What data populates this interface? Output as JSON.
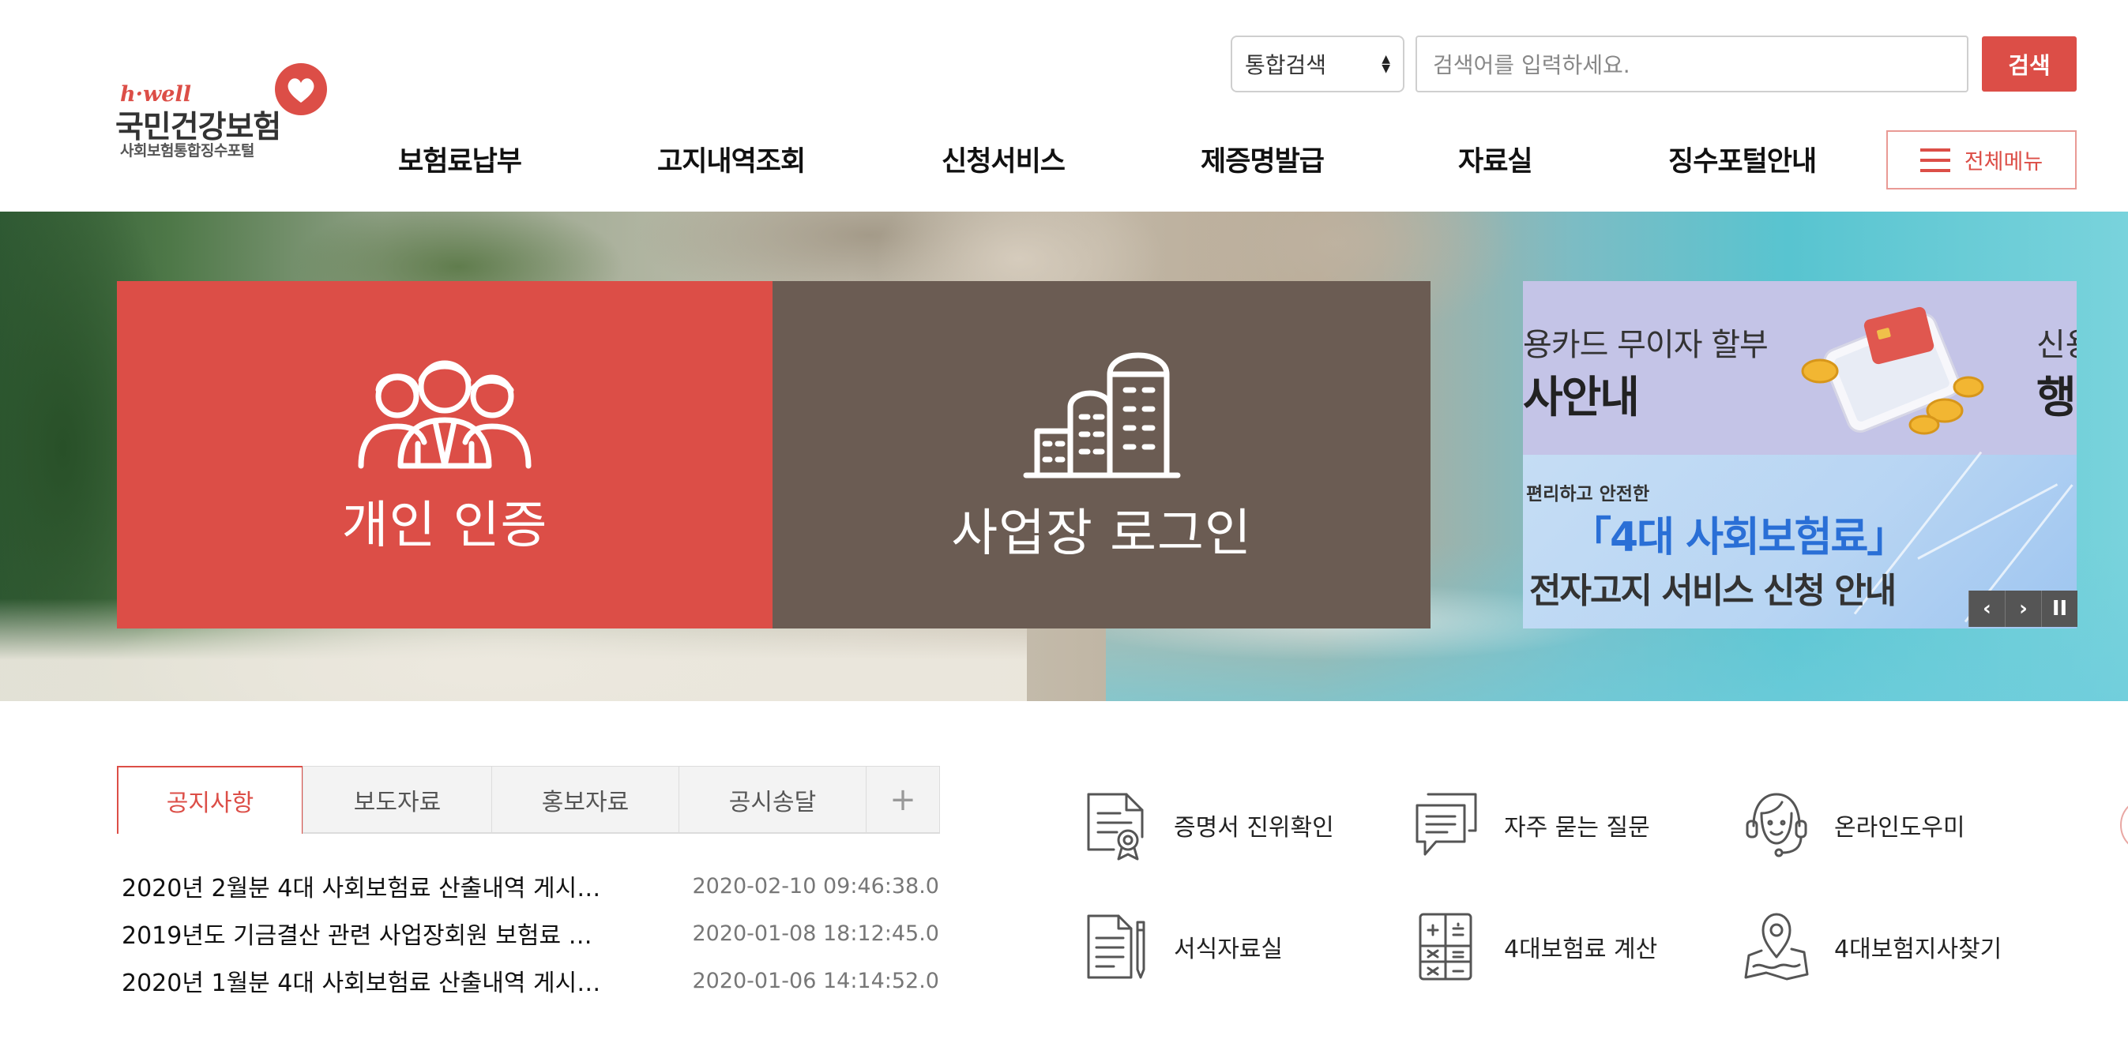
{
  "header": {
    "logo": {
      "tagline": "h·well",
      "brand": "국민건강보험",
      "sub": "사회보험통합징수포털"
    },
    "search": {
      "select_value": "통합검색",
      "placeholder": "검색어를 입력하세요.",
      "button_label": "검색"
    },
    "nav": [
      "보험료납부",
      "고지내역조회",
      "신청서비스",
      "제증명발급",
      "자료실",
      "징수포털안내"
    ],
    "all_menu_label": "전체메뉴"
  },
  "hero": {
    "personal_label": "개인 인증",
    "business_label": "사업장 로그인",
    "banner_top": {
      "line1": "용카드 무이자 할부",
      "line2": "사안내",
      "line3": "신용",
      "line4": "행"
    },
    "banner_bottom": {
      "line1": "편리하고 안전한",
      "line2": "「4대 사회보험료」",
      "line3": "전자고지 서비스 신청 안내"
    },
    "controls": {
      "prev": "‹",
      "next": "›",
      "pause": "II"
    }
  },
  "board": {
    "tabs": [
      "공지사항",
      "보도자료",
      "홍보자료",
      "공시송달"
    ],
    "active_tab": 0,
    "more_label": "+",
    "items": [
      {
        "title": "2020년 2월분 4대 사회보험료 산출내역 게시…",
        "date": "2020-02-10 09:46:38.0"
      },
      {
        "title": "2019년도 기금결산 관련 사업장회원 보험료 …",
        "date": "2020-01-08 18:12:45.0"
      },
      {
        "title": "2020년 1월분 4대 사회보험료 산출내역 게시…",
        "date": "2020-01-06 14:14:52.0"
      }
    ]
  },
  "quick_links": [
    {
      "label": "증명서 진위확인",
      "icon": "certificate-icon"
    },
    {
      "label": "자주 묻는 질문",
      "icon": "faq-icon"
    },
    {
      "label": "온라인도우미",
      "icon": "headset-icon"
    },
    {
      "label": "서식자료실",
      "icon": "document-pen-icon"
    },
    {
      "label": "4대보험료 계산",
      "icon": "calculator-icon"
    },
    {
      "label": "4대보험지사찾기",
      "icon": "map-pin-icon"
    }
  ],
  "colors": {
    "accent": "#dc4e47",
    "business": "#6b5c53",
    "banner_top": "#c4c4e7",
    "banner_bottom": "#b8d5f3"
  }
}
